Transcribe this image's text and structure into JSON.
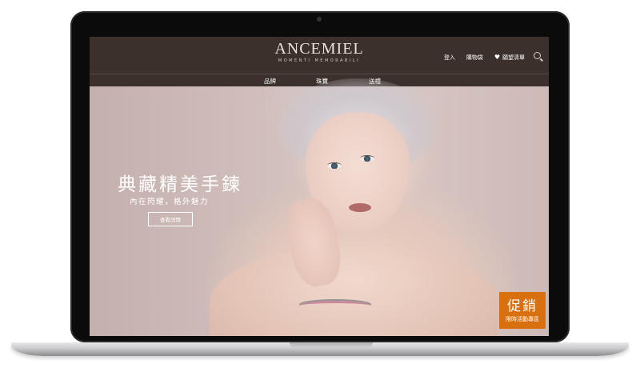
{
  "header": {
    "logo": "ANCEMIEL",
    "tagline": "MOMENTI MEMORABILI",
    "login_label": "登入",
    "cart_label": "購物袋",
    "wishlist_label": "願望清單"
  },
  "nav": {
    "items": [
      {
        "label": "品牌"
      },
      {
        "label": "珠寶"
      },
      {
        "label": "送禮"
      }
    ]
  },
  "hero": {
    "title": "典藏精美手鍊",
    "subtitle": "內在閃耀，格外魅力",
    "button_label": "查看詳情"
  },
  "promo": {
    "title": "促銷",
    "subtitle": "限時活動專區",
    "color": "#d8700f"
  },
  "icons": {
    "wishlist": "heart-icon",
    "search": "search-icon"
  },
  "colors": {
    "header_bg": "#3b302c",
    "hero_bg": "#d7c6c2"
  }
}
